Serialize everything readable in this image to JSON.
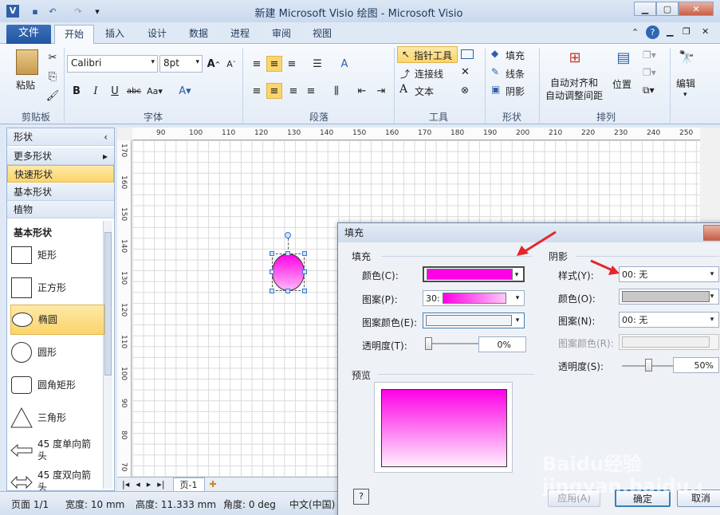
{
  "titlebar": {
    "title": "新建 Microsoft Visio 绘图 - Microsoft Visio"
  },
  "tabs": [
    "文件",
    "开始",
    "插入",
    "设计",
    "数据",
    "进程",
    "审阅",
    "视图"
  ],
  "ribbon": {
    "clipboard": {
      "paste": "粘贴",
      "label": "剪贴板"
    },
    "font": {
      "family": "Calibri",
      "size": "8pt",
      "label": "字体"
    },
    "paragraph": {
      "label": "段落"
    },
    "tools": {
      "pointer": "指针工具",
      "connector": "连接线",
      "text": "文本",
      "label": "工具"
    },
    "shape": {
      "fill": "填充",
      "line": "线条",
      "shadow": "阴影",
      "label": "形状"
    },
    "arrange": {
      "auto": "自动对齐和\n自动调整间距",
      "position": "位置",
      "label": "排列"
    },
    "edit": {
      "label": "编辑"
    }
  },
  "shapes_pane": {
    "title": "形状",
    "more": "更多形状",
    "quick": "快速形状",
    "basic": "基本形状",
    "plants": "植物",
    "section": "基本形状",
    "items": [
      "矩形",
      "正方形",
      "椭圆",
      "圆形",
      "圆角矩形",
      "三角形",
      "45 度单向箭头",
      "45 度双向箭头"
    ]
  },
  "ruler_h": [
    "90",
    "100",
    "110",
    "120",
    "130",
    "140",
    "150",
    "160",
    "170",
    "180",
    "190",
    "200",
    "210",
    "220",
    "230",
    "240",
    "250"
  ],
  "ruler_v": [
    "170",
    "160",
    "150",
    "140",
    "130",
    "120",
    "110",
    "100",
    "90",
    "80",
    "70"
  ],
  "page_tab": "页-1",
  "status": {
    "page": "页面 1/1",
    "width": "宽度: 10 mm",
    "height": "高度: 11.333 mm",
    "angle": "角度: 0 deg",
    "lang": "中文(中国)"
  },
  "dialog": {
    "title": "填充",
    "fill_section": "填充",
    "color_label": "颜色(C):",
    "pattern_label": "图案(P):",
    "pattern_value": "30:",
    "pattern_color_label": "图案颜色(E):",
    "transparency_label": "透明度(T):",
    "transparency_value": "0%",
    "preview_label": "预览",
    "shadow_section": "阴影",
    "style_label": "样式(Y):",
    "style_value": "00: 无",
    "shadow_color_label": "颜色(O):",
    "shadow_pattern_label": "图案(N):",
    "shadow_pattern_value": "00: 无",
    "shadow_pattern_color_label": "图案颜色(R):",
    "shadow_transparency_label": "透明度(S):",
    "shadow_transparency_value": "50%",
    "apply": "应用(A)",
    "ok": "确定",
    "cancel": "取消"
  },
  "watermark": "Baidu经验  jingyan.baidu.com",
  "colors": {
    "magenta": "#ff00e6",
    "accent": "#1f56a3",
    "highlight": "#fbd46b"
  }
}
